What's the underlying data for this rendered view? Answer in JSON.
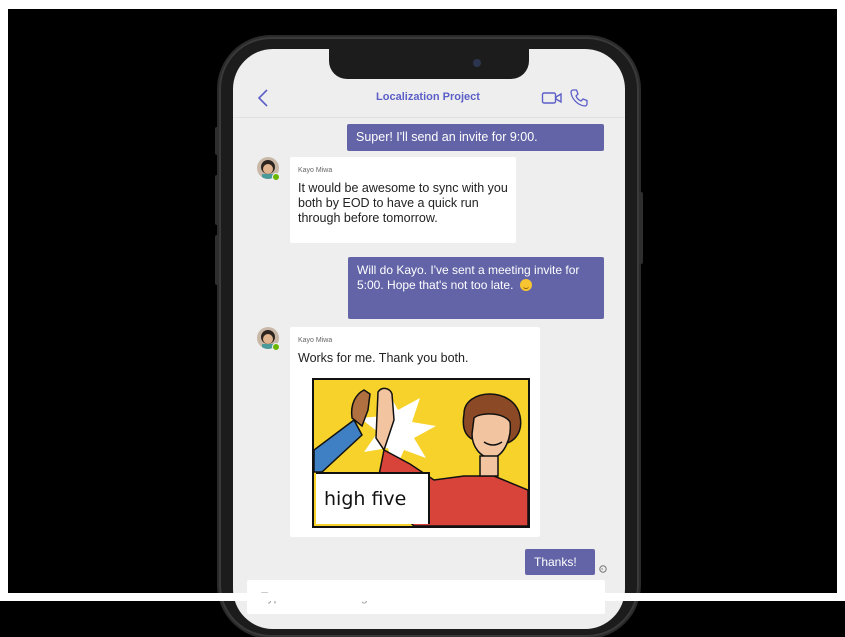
{
  "header": {
    "title": "Localization Project",
    "icons": [
      "back-icon",
      "video-call-icon",
      "phone-call-icon"
    ]
  },
  "messages": [
    {
      "type": "outgoing",
      "text": "Super! I'll send an invite for 9:00."
    },
    {
      "type": "incoming",
      "sender": "Kayo Miwa",
      "text": "It would be awesome to sync with you both by EOD to have a quick run through before tomorrow."
    },
    {
      "type": "outgoing",
      "text": "Will do Kayo. I've sent a meeting invite for 5:00. Hope that's not too late."
    },
    {
      "type": "incoming",
      "sender": "Kayo Miwa",
      "text": "Works for me. Thank you both.",
      "sticker_label": "high five"
    },
    {
      "type": "outgoing",
      "text": "Thanks!"
    }
  ],
  "compose": {
    "placeholder": "Type a new message"
  },
  "colors": {
    "accent": "#6264a7",
    "background": "#eeeeee",
    "presence": "#6bb700"
  }
}
